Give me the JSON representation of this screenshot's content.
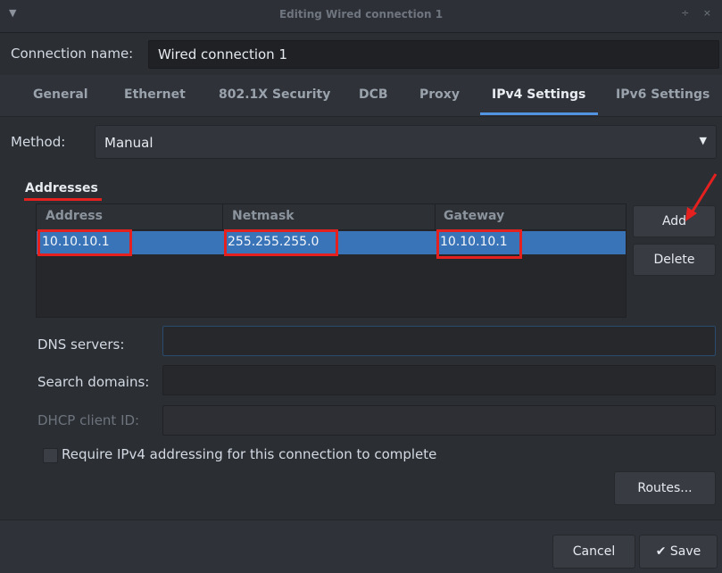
{
  "window": {
    "title": "Editing Wired connection 1",
    "menu_icon": "chevron-down-icon",
    "controls": "÷ ×"
  },
  "connection": {
    "label": "Connection name:",
    "value": "Wired connection 1"
  },
  "tabs": [
    {
      "label": "General"
    },
    {
      "label": "Ethernet"
    },
    {
      "label": "802.1X Security"
    },
    {
      "label": "DCB"
    },
    {
      "label": "Proxy"
    },
    {
      "label": "IPv4 Settings",
      "active": true
    },
    {
      "label": "IPv6 Settings"
    }
  ],
  "method": {
    "label": "Method:",
    "value": "Manual"
  },
  "addresses": {
    "title": "Addresses",
    "columns": [
      "Address",
      "Netmask",
      "Gateway"
    ],
    "rows": [
      {
        "address": "10.10.10.1",
        "netmask": "255.255.255.0",
        "gateway": "10.10.10.1",
        "selected": true
      }
    ],
    "add_label": "Add",
    "delete_label": "Delete"
  },
  "fields": {
    "dns_label": "DNS servers:",
    "search_label": "Search domains:",
    "dhcp_label": "DHCP client ID:"
  },
  "require_ipv4": {
    "label": "Require IPv4 addressing for this connection to complete",
    "checked": false
  },
  "routes_label": "Routes...",
  "footer": {
    "cancel_label": "Cancel",
    "save_label": "Save",
    "save_icon": "checkmark-icon"
  },
  "colors": {
    "accent": "#5294e2",
    "selection": "#3a74b8",
    "annotation": "#e52120",
    "background": "#2b2e33"
  }
}
